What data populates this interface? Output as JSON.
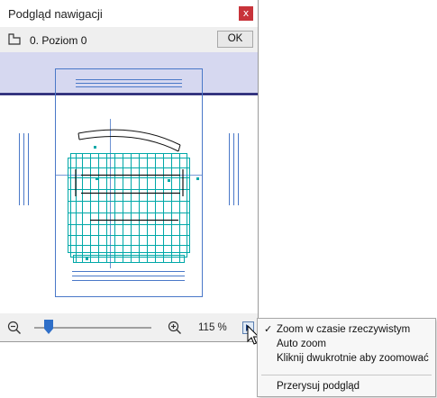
{
  "window": {
    "title": "Podgląd nawigacji",
    "close_glyph": "x"
  },
  "story": {
    "icon": "story-icon",
    "label": "0. Poziom 0",
    "ok_label": "OK"
  },
  "zoom": {
    "value_label": "115 %",
    "zoom_out_icon": "zoom-out-icon",
    "zoom_in_icon": "zoom-in-icon",
    "slider_position": 0.12
  },
  "context_menu": {
    "items": [
      {
        "label": "Zoom w czasie rzeczywistym",
        "checked": true,
        "check_glyph": "✓"
      },
      {
        "label": "Auto zoom",
        "checked": false
      },
      {
        "label": "Kliknij dwukrotnie aby zoomować",
        "checked": false
      },
      {
        "label": "Przerysuj podgląd",
        "checked": false
      }
    ]
  },
  "colors": {
    "plan_lines": "#00a8a8",
    "sheet_outline": "#4a78c8",
    "top_band": "#d6d8f0",
    "navy_line": "#1a1a6e",
    "close_button": "#c8333a",
    "slider_thumb": "#2f6fc8"
  }
}
